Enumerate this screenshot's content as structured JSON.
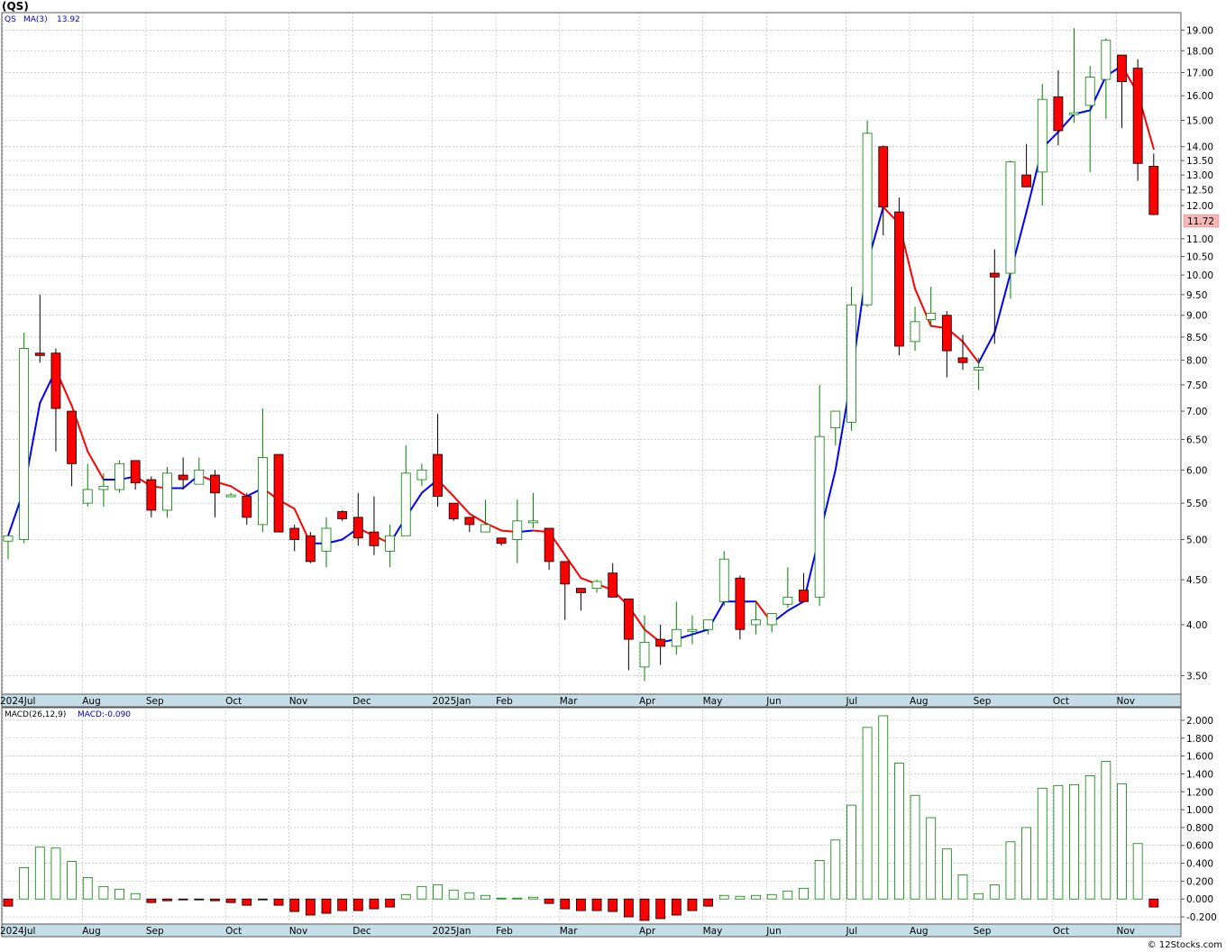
{
  "header": {
    "ticker_title": "(QS)"
  },
  "price_panel": {
    "legend_symbol": "QS",
    "legend_ma_label": "MA(3)",
    "legend_ma_value": "13.92",
    "last_price_label": "11.72"
  },
  "macd_panel": {
    "legend_label": "MACD(26,12,9)",
    "legend_value": "MACD:-0.090"
  },
  "footer": {
    "copyright": "© 12Stocks.com"
  },
  "colors": {
    "up": "#008000",
    "down": "#ff0000",
    "ma_up": "#0000ff",
    "ma_down": "#ff0000",
    "grid": "#b0b0b0",
    "axis_bar": "#c4dde6",
    "last_price_bg": "#f4b6b6"
  },
  "chart_data": [
    {
      "type": "candlestick",
      "title": "(QS)",
      "y_scale": "log",
      "ylim": [
        3.35,
        19.8
      ],
      "y_ticks": [
        "19.00",
        "18.00",
        "17.00",
        "16.00",
        "15.00",
        "14.00",
        "13.50",
        "13.00",
        "12.50",
        "12.00",
        "11.00",
        "10.50",
        "10.00",
        "9.50",
        "9.00",
        "8.50",
        "8.00",
        "7.50",
        "7.00",
        "6.50",
        "6.00",
        "5.50",
        "5.00",
        "4.50",
        "4.00",
        "3.50"
      ],
      "x_labels": [
        "2024Jul",
        "Aug",
        "Sep",
        "Oct",
        "Nov",
        "Dec",
        "2025Jan",
        "Feb",
        "Mar",
        "Apr",
        "May",
        "Jun",
        "Jul",
        "Aug",
        "Sep",
        "Oct",
        "Nov"
      ],
      "x_label_week_index": [
        0,
        5,
        9,
        14,
        18,
        22,
        27,
        31,
        35,
        40,
        44,
        48,
        53,
        57,
        61,
        66,
        70
      ],
      "grid": true,
      "candles": [
        {
          "o": 4.98,
          "h": 5.05,
          "l": 4.75,
          "c": 5.05
        },
        {
          "o": 5.0,
          "h": 8.6,
          "l": 4.95,
          "c": 8.25
        },
        {
          "o": 8.15,
          "h": 9.5,
          "l": 7.95,
          "c": 8.1
        },
        {
          "o": 8.15,
          "h": 8.25,
          "l": 6.3,
          "c": 7.05
        },
        {
          "o": 7.0,
          "h": 7.0,
          "l": 5.75,
          "c": 6.1
        },
        {
          "o": 5.5,
          "h": 6.1,
          "l": 5.45,
          "c": 5.7
        },
        {
          "o": 5.7,
          "h": 5.95,
          "l": 5.45,
          "c": 5.75
        },
        {
          "o": 5.7,
          "h": 6.15,
          "l": 5.65,
          "c": 6.1
        },
        {
          "o": 6.15,
          "h": 6.15,
          "l": 5.7,
          "c": 5.8
        },
        {
          "o": 5.85,
          "h": 5.9,
          "l": 5.3,
          "c": 5.4
        },
        {
          "o": 5.4,
          "h": 6.05,
          "l": 5.3,
          "c": 5.95
        },
        {
          "o": 5.92,
          "h": 6.2,
          "l": 5.7,
          "c": 5.85
        },
        {
          "o": 5.78,
          "h": 6.2,
          "l": 5.8,
          "c": 6.0
        },
        {
          "o": 5.92,
          "h": 6.0,
          "l": 5.3,
          "c": 5.65
        },
        {
          "o": 5.62,
          "h": 5.65,
          "l": 5.6,
          "c": 5.62
        },
        {
          "o": 5.6,
          "h": 5.65,
          "l": 5.2,
          "c": 5.3
        },
        {
          "o": 5.2,
          "h": 7.05,
          "l": 5.1,
          "c": 6.2
        },
        {
          "o": 6.25,
          "h": 6.25,
          "l": 5.1,
          "c": 5.1
        },
        {
          "o": 5.15,
          "h": 5.2,
          "l": 4.85,
          "c": 5.0
        },
        {
          "o": 5.05,
          "h": 5.1,
          "l": 4.7,
          "c": 4.72
        },
        {
          "o": 4.85,
          "h": 5.3,
          "l": 4.65,
          "c": 5.15
        },
        {
          "o": 5.38,
          "h": 5.4,
          "l": 5.25,
          "c": 5.28
        },
        {
          "o": 5.3,
          "h": 5.65,
          "l": 4.92,
          "c": 5.02
        },
        {
          "o": 5.1,
          "h": 5.6,
          "l": 4.8,
          "c": 4.92
        },
        {
          "o": 4.85,
          "h": 5.2,
          "l": 4.65,
          "c": 5.05
        },
        {
          "o": 5.05,
          "h": 6.4,
          "l": 5.05,
          "c": 5.95
        },
        {
          "o": 5.85,
          "h": 6.1,
          "l": 5.75,
          "c": 6.0
        },
        {
          "o": 6.25,
          "h": 6.95,
          "l": 5.45,
          "c": 5.6
        },
        {
          "o": 5.5,
          "h": 5.5,
          "l": 5.25,
          "c": 5.28
        },
        {
          "o": 5.3,
          "h": 5.3,
          "l": 5.1,
          "c": 5.2
        },
        {
          "o": 5.1,
          "h": 5.55,
          "l": 5.1,
          "c": 5.2
        },
        {
          "o": 5.02,
          "h": 5.02,
          "l": 4.92,
          "c": 4.95
        },
        {
          "o": 5.0,
          "h": 5.55,
          "l": 4.7,
          "c": 5.25
        },
        {
          "o": 5.25,
          "h": 5.65,
          "l": 5.15,
          "c": 5.25
        },
        {
          "o": 5.15,
          "h": 5.15,
          "l": 4.62,
          "c": 4.72
        },
        {
          "o": 4.72,
          "h": 4.72,
          "l": 4.05,
          "c": 4.45
        },
        {
          "o": 4.4,
          "h": 4.4,
          "l": 4.15,
          "c": 4.35
        },
        {
          "o": 4.4,
          "h": 4.5,
          "l": 4.35,
          "c": 4.48
        },
        {
          "o": 4.58,
          "h": 4.7,
          "l": 4.3,
          "c": 4.3
        },
        {
          "o": 4.28,
          "h": 4.28,
          "l": 3.55,
          "c": 3.85
        },
        {
          "o": 3.58,
          "h": 4.1,
          "l": 3.45,
          "c": 3.82
        },
        {
          "o": 3.85,
          "h": 4.0,
          "l": 3.6,
          "c": 3.78
        },
        {
          "o": 3.78,
          "h": 4.25,
          "l": 3.7,
          "c": 3.95
        },
        {
          "o": 3.95,
          "h": 4.1,
          "l": 3.8,
          "c": 3.95
        },
        {
          "o": 3.95,
          "h": 4.05,
          "l": 3.9,
          "c": 4.05
        },
        {
          "o": 4.25,
          "h": 4.85,
          "l": 4.2,
          "c": 4.75
        },
        {
          "o": 4.52,
          "h": 4.55,
          "l": 3.85,
          "c": 3.95
        },
        {
          "o": 4.0,
          "h": 4.25,
          "l": 3.9,
          "c": 4.05
        },
        {
          "o": 4.0,
          "h": 4.12,
          "l": 3.92,
          "c": 4.12
        },
        {
          "o": 4.22,
          "h": 4.65,
          "l": 4.18,
          "c": 4.3
        },
        {
          "o": 4.38,
          "h": 4.58,
          "l": 4.25,
          "c": 4.25
        },
        {
          "o": 4.3,
          "h": 7.5,
          "l": 4.2,
          "c": 6.55
        },
        {
          "o": 6.7,
          "h": 6.8,
          "l": 6.4,
          "c": 7.0
        },
        {
          "o": 6.8,
          "h": 9.7,
          "l": 6.65,
          "c": 9.25
        },
        {
          "o": 9.25,
          "h": 15.0,
          "l": 9.2,
          "c": 14.5
        },
        {
          "o": 14.0,
          "h": 14.05,
          "l": 11.1,
          "c": 11.95
        },
        {
          "o": 11.8,
          "h": 12.25,
          "l": 8.1,
          "c": 8.3
        },
        {
          "o": 8.4,
          "h": 9.2,
          "l": 8.2,
          "c": 8.85
        },
        {
          "o": 8.9,
          "h": 9.7,
          "l": 8.75,
          "c": 9.05
        },
        {
          "o": 9.0,
          "h": 9.1,
          "l": 7.65,
          "c": 8.2
        },
        {
          "o": 8.05,
          "h": 8.55,
          "l": 7.8,
          "c": 7.95
        },
        {
          "o": 7.8,
          "h": 8.05,
          "l": 7.4,
          "c": 7.85
        },
        {
          "o": 10.05,
          "h": 10.7,
          "l": 8.35,
          "c": 9.95
        },
        {
          "o": 10.05,
          "h": 13.5,
          "l": 9.4,
          "c": 13.45
        },
        {
          "o": 13.0,
          "h": 14.1,
          "l": 12.7,
          "c": 12.6
        },
        {
          "o": 13.1,
          "h": 16.5,
          "l": 12.0,
          "c": 15.85
        },
        {
          "o": 15.95,
          "h": 17.1,
          "l": 14.05,
          "c": 14.6
        },
        {
          "o": 15.3,
          "h": 19.1,
          "l": 14.9,
          "c": 15.3
        },
        {
          "o": 15.6,
          "h": 17.3,
          "l": 13.1,
          "c": 16.8
        },
        {
          "o": 16.7,
          "h": 18.6,
          "l": 15.05,
          "c": 18.5
        },
        {
          "o": 17.8,
          "h": 17.8,
          "l": 14.7,
          "c": 16.6
        },
        {
          "o": 17.2,
          "h": 17.6,
          "l": 12.8,
          "c": 13.4
        },
        {
          "o": 13.3,
          "h": 13.75,
          "l": 11.7,
          "c": 11.72
        }
      ],
      "ma3": [
        5.05,
        5.7,
        7.15,
        7.8,
        7.1,
        6.3,
        5.85,
        5.85,
        5.9,
        5.75,
        5.72,
        5.72,
        5.92,
        5.82,
        5.75,
        5.6,
        5.72,
        5.55,
        5.42,
        4.95,
        4.95,
        5.0,
        5.15,
        5.05,
        4.95,
        5.3,
        5.65,
        5.85,
        5.6,
        5.35,
        5.22,
        5.12,
        5.1,
        5.12,
        5.1,
        4.8,
        4.52,
        4.45,
        4.38,
        4.2,
        3.95,
        3.82,
        3.85,
        3.9,
        3.95,
        4.25,
        4.25,
        4.25,
        4.02,
        4.15,
        4.25,
        5.05,
        6.0,
        7.65,
        10.3,
        11.95,
        11.45,
        9.65,
        8.75,
        8.7,
        8.4,
        7.95,
        8.6,
        10.05,
        11.8,
        13.95,
        14.55,
        15.25,
        15.4,
        16.85,
        17.3,
        16.1,
        13.92
      ]
    },
    {
      "type": "bar",
      "title": "MACD(26,12,9)",
      "ylim": [
        -0.24,
        2.05
      ],
      "y_ticks": [
        "2.000",
        "1.800",
        "1.600",
        "1.400",
        "1.200",
        "1.000",
        "0.800",
        "0.600",
        "0.400",
        "0.200",
        "0.000",
        "-0.200"
      ],
      "values": [
        -0.08,
        0.35,
        0.58,
        0.57,
        0.42,
        0.24,
        0.14,
        0.11,
        0.06,
        -0.04,
        -0.02,
        -0.01,
        -0.01,
        -0.02,
        -0.04,
        -0.07,
        -0.01,
        -0.07,
        -0.14,
        -0.18,
        -0.16,
        -0.13,
        -0.13,
        -0.11,
        -0.09,
        0.05,
        0.14,
        0.16,
        0.1,
        0.07,
        0.04,
        0.01,
        0.01,
        0.02,
        -0.05,
        -0.11,
        -0.13,
        -0.13,
        -0.14,
        -0.2,
        -0.24,
        -0.22,
        -0.18,
        -0.13,
        -0.08,
        0.04,
        0.03,
        0.04,
        0.05,
        0.09,
        0.12,
        0.43,
        0.66,
        1.05,
        1.92,
        2.05,
        1.52,
        1.16,
        0.91,
        0.56,
        0.27,
        0.06,
        0.16,
        0.64,
        0.8,
        1.24,
        1.27,
        1.28,
        1.38,
        1.54,
        1.29,
        0.62,
        -0.09
      ]
    }
  ]
}
